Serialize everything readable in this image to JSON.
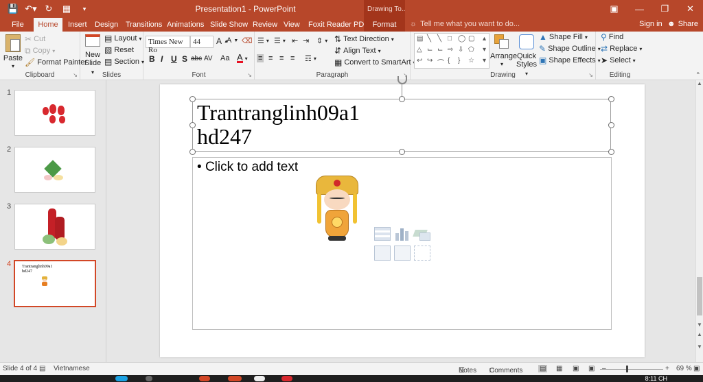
{
  "window": {
    "title": "Presentation1 - PowerPoint",
    "context_tab_header": "Drawing To...",
    "sign_in": "Sign in",
    "share": "Share"
  },
  "qat": [
    "save-icon",
    "undo-icon",
    "redo-icon",
    "start-from-beginning-icon",
    "customize-qat-icon"
  ],
  "tabs": {
    "file": "File",
    "home": "Home",
    "insert": "Insert",
    "design": "Design",
    "transitions": "Transitions",
    "animations": "Animations",
    "slideshow": "Slide Show",
    "review": "Review",
    "view": "View",
    "foxit": "Foxit Reader PDF",
    "format": "Format"
  },
  "tell_me": "Tell me what you want to do...",
  "ribbon": {
    "clipboard": {
      "label": "Clipboard",
      "paste": "Paste",
      "cut": "Cut",
      "copy": "Copy",
      "format_painter": "Format Painter"
    },
    "slides": {
      "label": "Slides",
      "new_slide": "New",
      "new_slide2": "Slide",
      "layout": "Layout",
      "reset": "Reset",
      "section": "Section"
    },
    "font": {
      "label": "Font",
      "font_name": "Times New Ro",
      "font_size": "44",
      "bold": "B",
      "italic": "I",
      "underline": "U",
      "shadow": "S",
      "strike": "abc",
      "spacing": "AV",
      "case": "Aa"
    },
    "paragraph": {
      "label": "Paragraph",
      "text_direction": "Text Direction",
      "align_text": "Align Text",
      "smartart": "Convert to SmartArt"
    },
    "drawing": {
      "label": "Drawing",
      "arrange": "Arrange",
      "quick_styles": "Quick",
      "quick_styles2": "Styles",
      "shape_fill": "Shape Fill",
      "shape_outline": "Shape Outline",
      "shape_effects": "Shape Effects"
    },
    "editing": {
      "label": "Editing",
      "find": "Find",
      "replace": "Replace",
      "select": "Select"
    }
  },
  "slides": [
    {
      "number": "1"
    },
    {
      "number": "2"
    },
    {
      "number": "3"
    },
    {
      "number": "4",
      "thumb_title": "Trantranglinh09a1\nhd247"
    }
  ],
  "current_slide": {
    "title": "Trantranglinh09a1\nhd247",
    "content_placeholder": "Click to add text"
  },
  "status": {
    "slide_of": "Slide 4 of 4",
    "language": "Vietnamese",
    "notes": "Notes",
    "comments": "Comments",
    "zoom": "69 %",
    "clock": "8:11 CH"
  },
  "colors": {
    "accent": "#b7472a",
    "accent_dark": "#a3351b",
    "selection": "#d24726"
  }
}
